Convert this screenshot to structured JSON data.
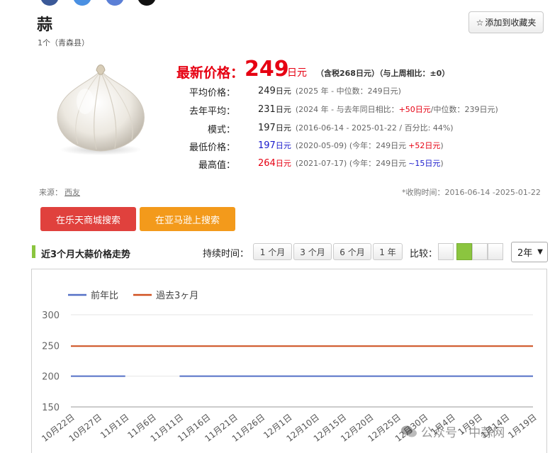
{
  "product": {
    "title": "蒜",
    "subtitle": "1个（青森县）",
    "favorite_label": "添加到收藏夹",
    "favorite_icon": "star-outline-icon"
  },
  "price": {
    "latest_label": "最新价格：",
    "latest_value": "249",
    "latest_unit": "日元",
    "latest_note": "（含税268日元）（与上周相比：±0）",
    "rows": [
      {
        "label": "平均价格：",
        "value": "249",
        "unit": "日元",
        "note": "(2025 年 - 中位数：249日元)",
        "highlight": "",
        "color": "#222222"
      },
      {
        "label": "去年平均：",
        "value": "231",
        "unit": "日元",
        "note_pre": "(2024 年 - 与去年同日相比：",
        "highlight": "+50日元",
        "note_post": "/中位数：239日元)",
        "color": "#222222"
      },
      {
        "label": "模式：",
        "value": "197",
        "unit": "日元",
        "note": "(2016-06-14 - 2025-01-22 / 百分比: 44%)",
        "highlight": "",
        "color": "#222222"
      },
      {
        "label": "最低价格：",
        "value": "197",
        "unit": "日元",
        "note_pre": "(2020-05-09) (今年：249日元",
        "highlight": "+52日元",
        "note_post": ")",
        "color": "#1a1acc"
      },
      {
        "label": "最高值：",
        "value": "264",
        "unit": "日元",
        "note_pre": "(2021-07-17) (今年：249日元",
        "highlight": "~15日元",
        "note_post": ")",
        "color": "#e60012"
      }
    ]
  },
  "source": {
    "label": "来源：",
    "link": "西友",
    "collect_period": "*收购时间：2016-06-14 -2025-01-22"
  },
  "buttons": {
    "rakuten": "在乐天商城搜索",
    "amazon": "在亚马逊上搜索"
  },
  "trend": {
    "title": "近3个月大蒜价格走势",
    "duration_label": "持续时间：",
    "durations": [
      "1 个月",
      "3 个月",
      "6 个月",
      "1 年"
    ],
    "compare_label": "比较：",
    "compare_colors": [
      "#f3f3f3",
      "#8bc53f",
      "#f3f3f3",
      "#f3f3f3"
    ],
    "year_option": "2年"
  },
  "chart_data": {
    "type": "line",
    "title": "",
    "xlabel": "",
    "ylabel": "",
    "ylim": [
      150,
      300
    ],
    "yticks": [
      150,
      200,
      250,
      300
    ],
    "x": [
      "10月22日",
      "10月27日",
      "11月1日",
      "11月6日",
      "11月11日",
      "11月16日",
      "11月21日",
      "11月26日",
      "12月1日",
      "12月10日",
      "12月15日",
      "12月20日",
      "12月25日",
      "12月30日",
      "1月4日",
      "1月9日",
      "1月14日",
      "1月19日"
    ],
    "grid": true,
    "legend_position": "top-left",
    "series": [
      {
        "name": "前年比",
        "color": "#5470c6",
        "values": [
          200,
          200,
          200,
          null,
          200,
          200,
          200,
          200,
          200,
          200,
          200,
          200,
          200,
          200,
          200,
          200,
          200,
          200
        ]
      },
      {
        "name": "過去3ヶ月",
        "color": "#d0501f",
        "values": [
          249,
          249,
          249,
          249,
          249,
          249,
          249,
          249,
          249,
          249,
          249,
          249,
          249,
          249,
          249,
          249,
          249,
          249
        ]
      }
    ]
  },
  "watermark": "公众号 · 中蒜网",
  "watermark_icon": "wechat-icon"
}
